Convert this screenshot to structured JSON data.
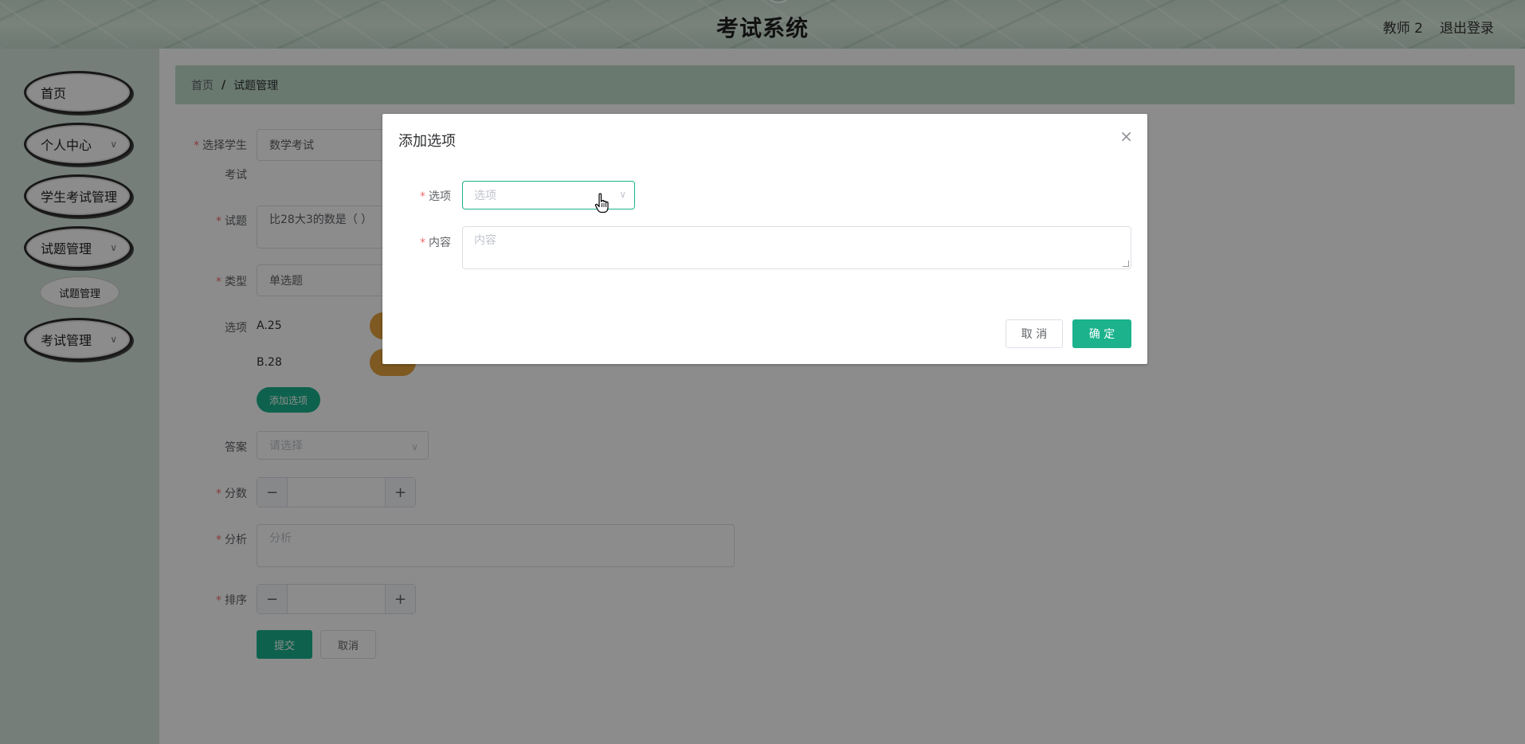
{
  "header": {
    "title": "考试系统",
    "user": "教师 2",
    "logout": "退出登录"
  },
  "sidebar": {
    "items": [
      {
        "label": "首页"
      },
      {
        "label": "个人中心",
        "expandable": true
      },
      {
        "label": "学生考试管理"
      },
      {
        "label": "试题管理",
        "expandable": true
      },
      {
        "label": "考试管理",
        "expandable": true
      }
    ],
    "sub_item": "试题管理"
  },
  "breadcrumb": {
    "home": "首页",
    "separator": "/",
    "current": "试题管理"
  },
  "form": {
    "exam_label_line1": "选择学生",
    "exam_label_line2": "考试",
    "exam_value": "数学考试",
    "question_label": "试题",
    "question_value": "比28大3的数是（    ）",
    "type_label": "类型",
    "type_value": "单选题",
    "options_label": "选项",
    "options": [
      {
        "text": "A.25"
      },
      {
        "text": "B.28"
      }
    ],
    "add_option_button": "添加选项",
    "answer_label": "答案",
    "answer_placeholder": "请选择",
    "score_label": "分数",
    "analysis_label": "分析",
    "analysis_placeholder": "分析",
    "sort_label": "排序",
    "submit": "提交",
    "cancel": "取消",
    "stepper_minus": "−",
    "stepper_plus": "+"
  },
  "dialog": {
    "title": "添加选项",
    "close": "×",
    "option_label": "选项",
    "option_placeholder": "选项",
    "content_label": "内容",
    "content_placeholder": "内容",
    "cancel": "取 消",
    "confirm": "确 定"
  },
  "colors": {
    "accent": "#1bb28c",
    "warning": "#e6a23c",
    "required": "#f56c6c"
  },
  "icons": {
    "chevron": "chevron-down-icon",
    "close": "close-icon",
    "cursor": "hand-pointer-icon"
  }
}
